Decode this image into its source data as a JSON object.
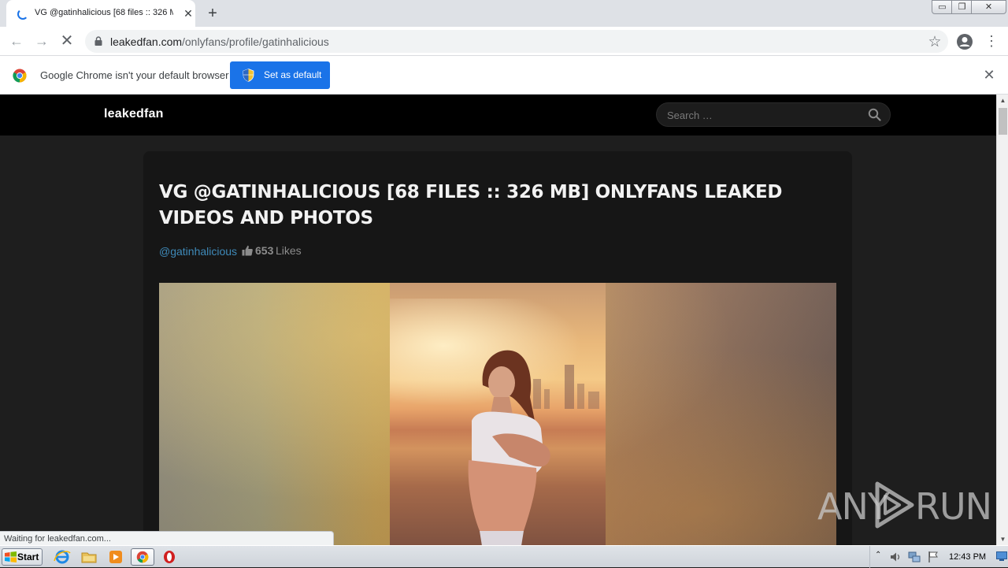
{
  "browser": {
    "tab": {
      "title": "VG @gatinhalicious [68 files :: 326 MB] OnlyFans Leaked Videos and Photos",
      "close": "✕"
    },
    "new_tab": "+",
    "window_controls": {
      "minimize": "▭",
      "maximize": "❐",
      "close": "✕"
    },
    "nav": {
      "back": "←",
      "forward": "→",
      "stop": "✕"
    },
    "url": {
      "host": "leakedfan.com",
      "path": "/onlyfans/profile/gatinhalicious"
    },
    "star": "☆",
    "menu": "⋮"
  },
  "infobar": {
    "message": "Google Chrome isn't your default browser",
    "button_label": "Set as default",
    "close": "✕"
  },
  "site": {
    "logo": "leakedfan",
    "search_placeholder": "Search …"
  },
  "post": {
    "title": "VG @GATINHALICIOUS [68 FILES :: 326 MB] ONLYFANS LEAKED VIDEOS AND PHOTOS",
    "profile": "@gatinhalicious",
    "likes_count": "653",
    "likes_label": "Likes"
  },
  "scrollbar": {
    "up": "▲",
    "down": "▼"
  },
  "status": "Waiting for leakedfan.com...",
  "watermark": {
    "left": "ANY",
    "right": "RUN"
  },
  "taskbar": {
    "start_label": "Start",
    "tray_arrow": "⌃",
    "clock": "12:43 PM"
  },
  "colors": {
    "accent": "#1a73e8",
    "link": "#3f8ab9",
    "page_bg": "#1e1e1e",
    "nav_bg": "#000000"
  }
}
